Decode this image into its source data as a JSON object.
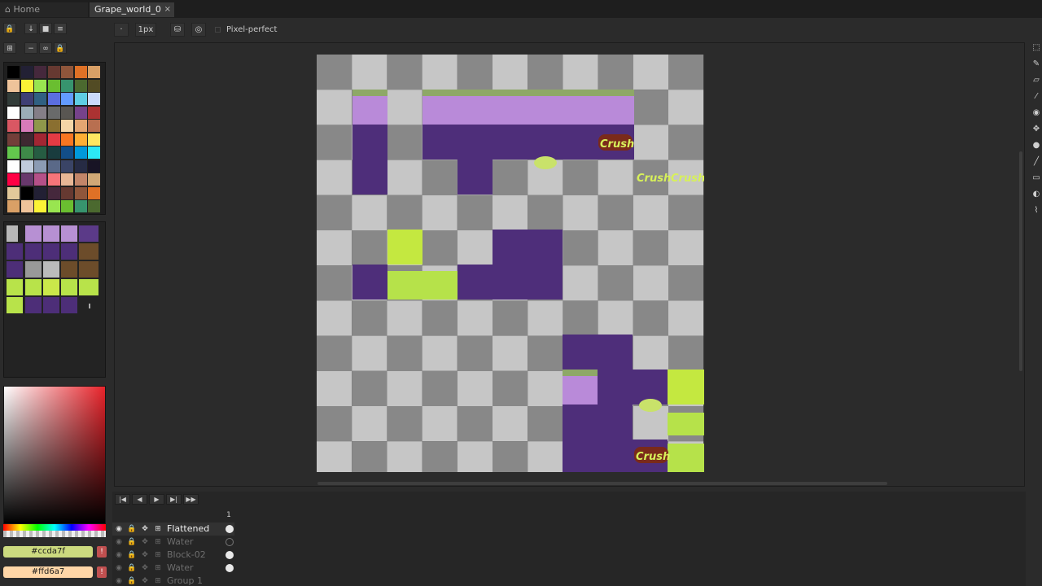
{
  "tabs": [
    {
      "label": "Home",
      "icon": "home-icon"
    },
    {
      "label": "Grape_world_0",
      "icon": "close-icon",
      "close": "×"
    }
  ],
  "context_toolbar": {
    "brush_size": "1px",
    "pixel_perfect_label": "Pixel-perfect"
  },
  "colors": {
    "foreground_hex": "#ccda7f",
    "background_hex": "#ffd6a7",
    "accent": "#ccda7f"
  },
  "timeline": {
    "current_frame": "1",
    "layers": [
      {
        "name": "Flattened",
        "active": true
      },
      {
        "name": "Water",
        "active": false
      },
      {
        "name": "Block-02",
        "active": false
      },
      {
        "name": "Water",
        "active": false
      },
      {
        "name": "Group 1",
        "active": false
      }
    ]
  },
  "sprite": {
    "crush_label": "Crush"
  },
  "icons": {
    "home": "home-icon",
    "close": "close-icon",
    "play": "play-icon",
    "eye": "eye-icon",
    "lock": "lock-icon"
  }
}
